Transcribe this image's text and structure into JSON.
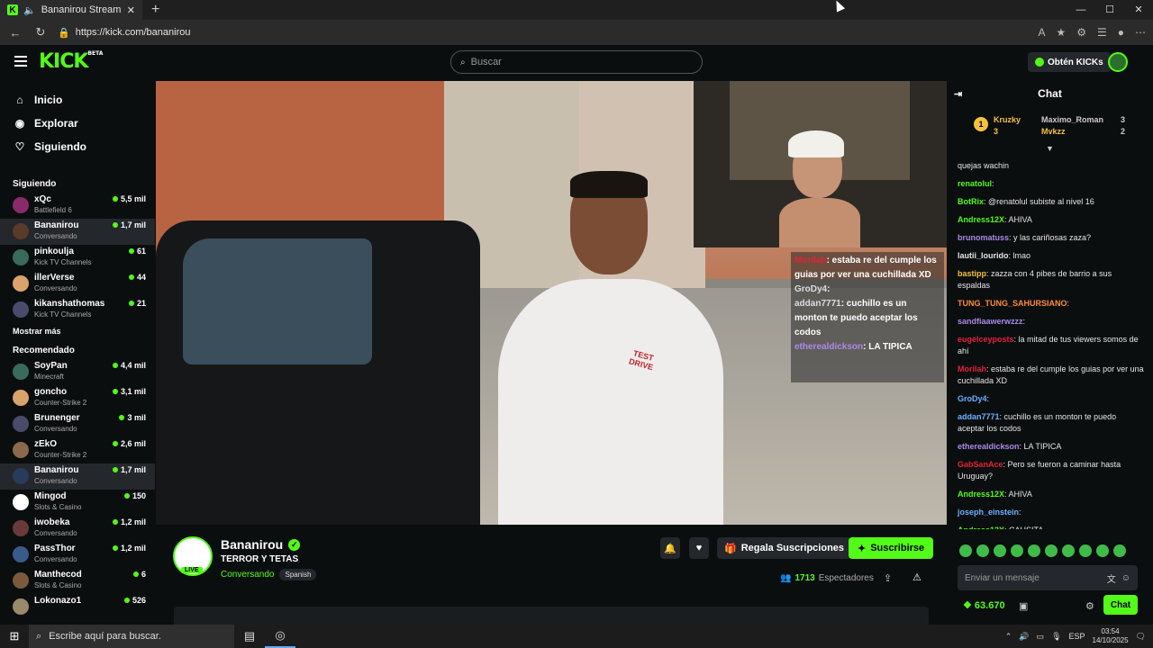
{
  "browser": {
    "tab_title": "Bananirou Stream - Watch L",
    "url": "https://kick.com/bananirou",
    "new_tab": "+",
    "minimize": "—",
    "maximize": "☐",
    "close": "✕"
  },
  "header": {
    "logo": "KICK",
    "logo_badge": "BETA",
    "search_placeholder": "Buscar",
    "kicks_button": "Obtén KICKs"
  },
  "sidebar": {
    "nav": [
      {
        "label": "Inicio",
        "icon": "home-icon"
      },
      {
        "label": "Explorar",
        "icon": "compass-icon"
      },
      {
        "label": "Siguiendo",
        "icon": "heart-icon"
      }
    ],
    "following_title": "Siguiendo",
    "following": [
      {
        "name": "xQc",
        "category": "Battlefield 6",
        "viewers": "5,5 mil"
      },
      {
        "name": "Bananirou",
        "category": "Conversando",
        "viewers": "1,7 mil"
      },
      {
        "name": "pinkoulja",
        "category": "Kick TV Channels",
        "viewers": "61"
      },
      {
        "name": "illerVerse",
        "category": "Conversando",
        "viewers": "44"
      },
      {
        "name": "kikanshathomas",
        "category": "Kick TV Channels",
        "viewers": "21"
      }
    ],
    "show_more": "Mostrar más",
    "recommended_title": "Recomendado",
    "recommended": [
      {
        "name": "SoyPan",
        "category": "Minecraft",
        "viewers": "4,4 mil"
      },
      {
        "name": "goncho",
        "category": "Counter-Strike 2",
        "viewers": "3,1 mil"
      },
      {
        "name": "Brunenger",
        "category": "Conversando",
        "viewers": "3 mil"
      },
      {
        "name": "zEkO",
        "category": "Counter-Strike 2",
        "viewers": "2,6 mil"
      },
      {
        "name": "Bananirou",
        "category": "Conversando",
        "viewers": "1,7 mil"
      },
      {
        "name": "Mingod",
        "category": "Slots & Casino",
        "viewers": "150"
      },
      {
        "name": "iwobeka",
        "category": "Conversando",
        "viewers": "1,2 mil"
      },
      {
        "name": "PassThor",
        "category": "Conversando",
        "viewers": "1,2 mil"
      },
      {
        "name": "Manthecod",
        "category": "Slots & Casino",
        "viewers": "6"
      },
      {
        "name": "Lokonazo1",
        "category": "",
        "viewers": "526"
      }
    ]
  },
  "video": {
    "overlay_chat": [
      {
        "user": "Morilah",
        "text": ": estaba re del cumple los guias por ver una cuchillada XD"
      },
      {
        "user": "GroDy4",
        "text": ":"
      },
      {
        "user": "addan7771",
        "text": ": cuchillo es un monton te puedo aceptar los codos"
      },
      {
        "user": "etherealdickson",
        "text": ": LA TIPICA"
      }
    ],
    "shirt_print": "TEST DRIVE"
  },
  "stream": {
    "name": "Bananirou",
    "title": "TERROR Y TETAS",
    "category": "Conversando",
    "language": "Spanish",
    "live": "LIVE",
    "gift_label": "Regala Suscripciones",
    "subscribe_label": "Suscribirse",
    "viewers": "1713",
    "viewers_label": "Espectadores"
  },
  "chat": {
    "title": "Chat",
    "leaderboard": [
      {
        "rank": "1",
        "name": "Kruzky",
        "count": "3"
      },
      {
        "name": "Maximo_Roman",
        "count": "3"
      },
      {
        "name": "Mvkzz",
        "count": "2"
      }
    ],
    "messages": [
      {
        "user": "",
        "text": "quejas wachin",
        "color": "#e6e6e6"
      },
      {
        "user": "renatolul",
        "text": ":",
        "color": "#53fc18"
      },
      {
        "user": "BotRix",
        "text": ": @renatolul subiste al nivel 16",
        "color": "#53fc18"
      },
      {
        "user": "Andress12X",
        "text": ": AHIVA",
        "color": "#53fc18"
      },
      {
        "user": "brunomatuss",
        "text": ": y las cariñosas zaza?",
        "color": "#a98be8"
      },
      {
        "user": "lautii_lourido",
        "text": ": lmao",
        "color": "#e6e6e6"
      },
      {
        "user": "bastipp",
        "text": ": zazza con 4 pibes de barrio a sus espaldas",
        "color": "#f5c042"
      },
      {
        "user": "TUNG_TUNG_SAHURSIANO",
        "text": ":",
        "color": "#ff8c3a"
      },
      {
        "user": "sandfiaawerwzzz",
        "text": ":",
        "color": "#a98be8"
      },
      {
        "user": "eugelceyposts",
        "text": ": la mitad de tus viewers somos de ahí",
        "color": "#e3213a"
      },
      {
        "user": "Morilah",
        "text": ": estaba re del cumple los guias por ver una cuchillada XD",
        "color": "#e3213a"
      },
      {
        "user": "GroDy4",
        "text": ":",
        "color": "#6ab0ff"
      },
      {
        "user": "addan7771",
        "text": ": cuchillo es un monton te puedo aceptar los codos",
        "color": "#6ab0ff"
      },
      {
        "user": "etherealdickson",
        "text": ": LA TIPICA",
        "color": "#a98be8"
      },
      {
        "user": "GabSanAce",
        "text": ": Pero se fueron a caminar hasta Uruguay?",
        "color": "#e3213a"
      },
      {
        "user": "Andress12X",
        "text": ": AHIVA",
        "color": "#53fc18"
      },
      {
        "user": "joseph_einstein",
        "text": ":",
        "color": "#6ab0ff"
      },
      {
        "user": "Andress12X",
        "text": ": CAUSITA",
        "color": "#53fc18"
      }
    ],
    "input_placeholder": "Enviar un mensaje",
    "points": "63.670",
    "send_label": "Chat"
  },
  "taskbar": {
    "search_placeholder": "Escribe aquí para buscar.",
    "language": "ESP",
    "time": "03:54",
    "date": "14/10/2025"
  }
}
